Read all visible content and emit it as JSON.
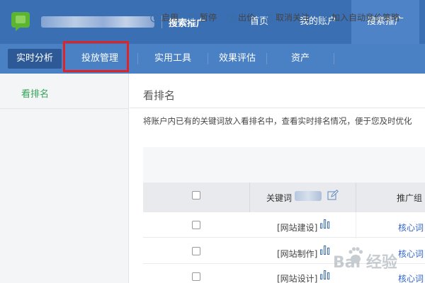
{
  "header": {
    "product": "搜索推广",
    "nav": [
      {
        "label": "首页",
        "active": false
      },
      {
        "label": "我的账户",
        "active": false
      },
      {
        "label": "搜索推广",
        "active": true
      }
    ]
  },
  "subnav": {
    "items": [
      {
        "label": "实时分析",
        "active": true
      },
      {
        "label": "投放管理",
        "highlighted": true
      },
      {
        "label": "实用工具"
      },
      {
        "label": "效果评估"
      },
      {
        "label": "资产"
      }
    ]
  },
  "sidebar": {
    "items": [
      {
        "label": "看排名",
        "active": true
      }
    ]
  },
  "main": {
    "title": "看排名",
    "description": "将账户内已有的关键词放入看排名中，查看实时排名情况，便于您及时优化",
    "toolbar": [
      {
        "label": "启用",
        "icon": "play-circle-icon"
      },
      {
        "label": "暂停",
        "icon": "pause-circle-icon"
      },
      {
        "label": "出价",
        "icon": "yen-circle-icon"
      },
      {
        "label": "取消关注",
        "icon": "unfollow-icon"
      },
      {
        "label": "加入自动竞价策略",
        "icon": "bar-chart-icon"
      }
    ],
    "table": {
      "columns": [
        "关键词",
        "推广组"
      ],
      "rows": [
        {
          "keyword": "[网站建设]",
          "group": "核心词"
        },
        {
          "keyword": "[网站制作]",
          "group": "核心词"
        },
        {
          "keyword": "[网站设计]",
          "group": "核心词"
        }
      ]
    }
  },
  "watermark": {
    "text": "Bai 经验"
  },
  "colors": {
    "header_bg": "#3b6fb3",
    "subnav_bg": "#4a80c4",
    "highlight": "#e0222a",
    "sidebar_active": "#33a457",
    "link": "#3366cc"
  }
}
